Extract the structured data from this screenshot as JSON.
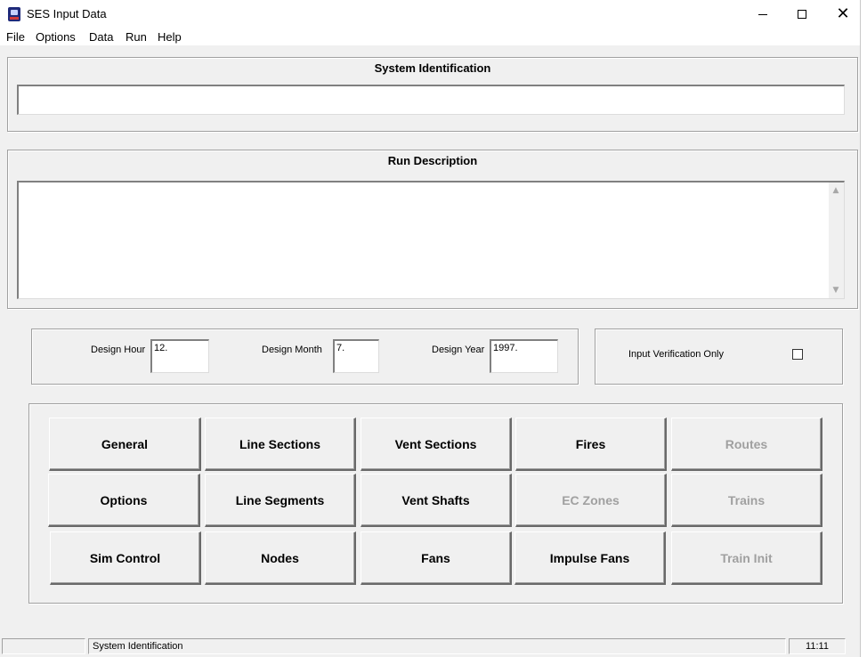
{
  "window": {
    "title": "SES Input Data",
    "app_icon": "ses-app-icon",
    "controls": [
      "minimize-icon",
      "maximize-icon",
      "close-icon"
    ],
    "close_glyph": "✕"
  },
  "menu": {
    "items": [
      "File",
      "Options",
      "Data",
      "Run",
      "Help"
    ]
  },
  "system_identification": {
    "title": "System Identification",
    "value": ""
  },
  "run_description": {
    "title": "Run Description",
    "value": "",
    "scroll_up_glyph": "▲",
    "scroll_down_glyph": "▼"
  },
  "design": {
    "hour_label": "Design Hour",
    "hour_value": "12.",
    "month_label": "Design Month",
    "month_value": "7.",
    "year_label": "Design Year",
    "year_value": "1997."
  },
  "verification": {
    "label": "Input Verification Only",
    "checked": false
  },
  "buttons": {
    "general": "General",
    "line_sections": "Line Sections",
    "vent_sections": "Vent Sections",
    "fires": "Fires",
    "routes": "Routes",
    "options": "Options",
    "line_segments": "Line Segments",
    "vent_shafts": "Vent Shafts",
    "ec_zones": "EC Zones",
    "trains": "Trains",
    "sim_control": "Sim Control",
    "nodes": "Nodes",
    "fans": "Fans",
    "impulse_fans": "Impulse Fans",
    "train_init": "Train Init"
  },
  "statusbar": {
    "pane1": "",
    "pane2": "System Identification",
    "time": "11:11"
  }
}
